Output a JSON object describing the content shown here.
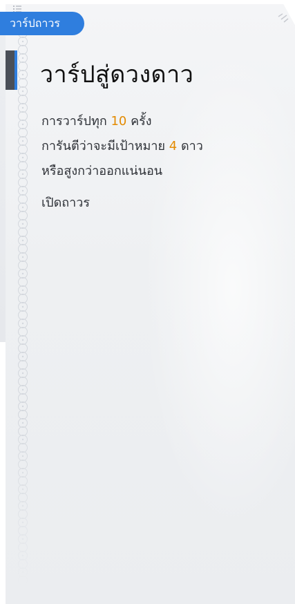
{
  "tab": {
    "label": "วาร์ปถาวร"
  },
  "banner": {
    "title": "วาร์ปสู่ดวงดาว",
    "description": {
      "line1": {
        "before": "การวาร์ปทุก ",
        "number": "10",
        "after": " ครั้ง"
      },
      "line2": {
        "before": "การันตีว่าจะมีเป้าหมาย ",
        "number": "4",
        "after": " ดาว"
      },
      "line3": "หรือสูงกว่าออกแน่นอน"
    },
    "status": "เปิดถาวร"
  },
  "colors": {
    "accent_blue": "#2f7ede",
    "highlight_orange": "#e38a00",
    "text_dark": "#2e3137",
    "title_black": "#111111",
    "panel_bg": "#eef0f2"
  },
  "icons": {
    "top_marks": "list-marks-icon",
    "corner_marks": "corner-decoration-icon",
    "pattern": "ornament-pattern-strip"
  }
}
